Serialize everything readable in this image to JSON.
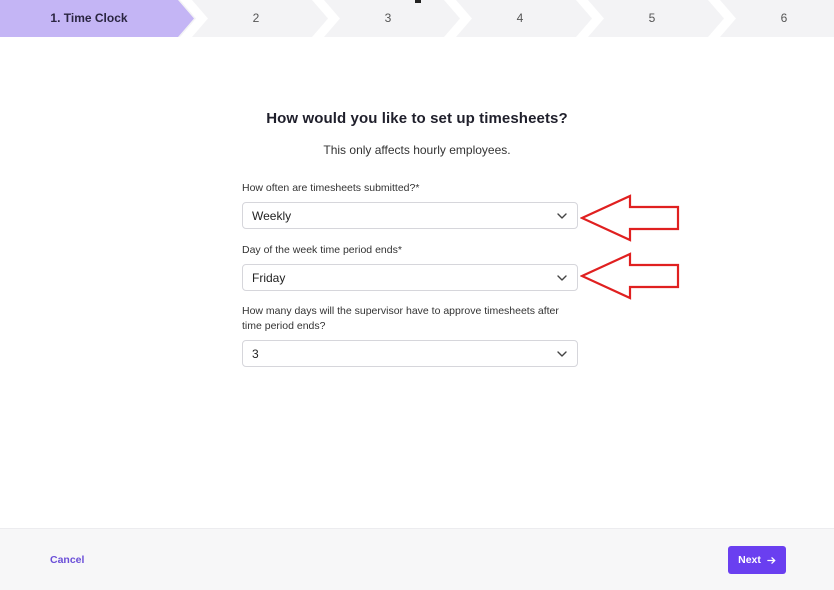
{
  "stepper": {
    "steps": [
      {
        "label": "1. Time Clock",
        "active": true
      },
      {
        "label": "2",
        "active": false
      },
      {
        "label": "3",
        "active": false
      },
      {
        "label": "4",
        "active": false
      },
      {
        "label": "5",
        "active": false
      },
      {
        "label": "6",
        "active": false
      }
    ],
    "active_color": "#c4b5f5",
    "inactive_color": "#f3f3f5"
  },
  "main": {
    "title": "How would you like to set up timesheets?",
    "subtitle": "This only affects hourly employees.",
    "fields": [
      {
        "label": "How often are timesheets submitted?*",
        "value": "Weekly"
      },
      {
        "label": "Day of the week time period ends*",
        "value": "Friday"
      },
      {
        "label": "How many days will the supervisor have to approve timesheets after time period ends?",
        "value": "3"
      }
    ]
  },
  "annotations": {
    "arrow_color": "#e02020"
  },
  "footer": {
    "cancel_label": "Cancel",
    "next_label": "Next",
    "accent_color": "#6a3ff0"
  }
}
